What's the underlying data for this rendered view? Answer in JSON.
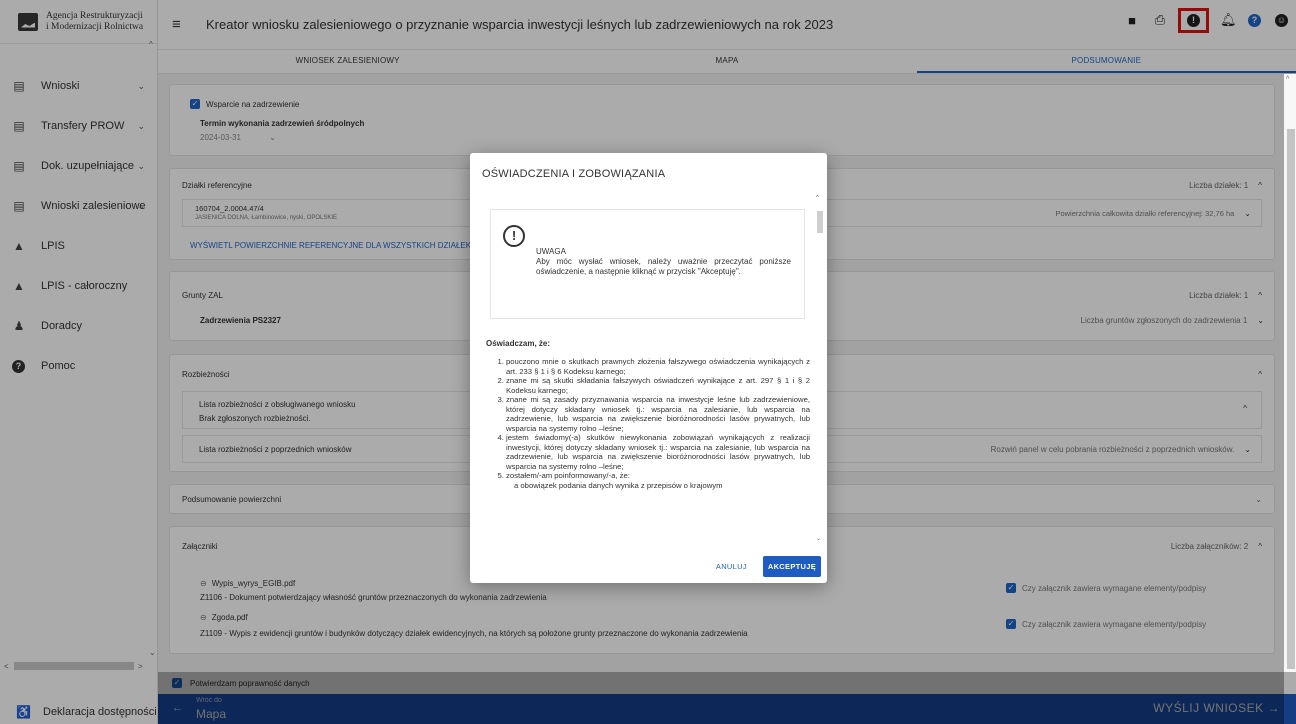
{
  "logo": {
    "line1": "Agencja Restrukturyzacji",
    "line2": "i Modernizacji Rolnictwa"
  },
  "app_title": "Kreator wniosku zalesieniowego o przyznanie wsparcia inwestycji leśnych lub zadrzewieniowych na rok 2023",
  "top_icons": [
    "save-icon",
    "print-icon",
    "info-icon",
    "bell-icon",
    "help-icon",
    "account-icon"
  ],
  "tabs": [
    {
      "label": "WNIOSEK ZALESIENIOWY"
    },
    {
      "label": "MAPA"
    },
    {
      "label": "PODSUMOWANIE",
      "active": true
    }
  ],
  "sidebar": {
    "items": [
      {
        "label": "Wnioski",
        "icon": "document-icon",
        "expandable": true
      },
      {
        "label": "Transfery PROW",
        "icon": "document-icon",
        "expandable": true
      },
      {
        "label": "Dok. uzupełniające",
        "icon": "document-icon",
        "expandable": true
      },
      {
        "label": "Wnioski zalesieniowe",
        "icon": "document-icon",
        "expandable": true
      },
      {
        "label": "LPIS",
        "icon": "mountain-icon"
      },
      {
        "label": "LPIS - całoroczny",
        "icon": "mountain-icon"
      },
      {
        "label": "Doradcy",
        "icon": "person-icon"
      },
      {
        "label": "Pomoc",
        "icon": "help-icon"
      }
    ],
    "footer": "Deklaracja dostępności"
  },
  "sections": {
    "support": {
      "checkbox_label": "Wsparcie na zadrzewienie",
      "term_label": "Termin wykonania zadrzewień śródpolnych",
      "term_value": "2024-03-31"
    },
    "plots": {
      "title": "Działki referencyjne",
      "count": "Liczba działek: 1",
      "plot_id": "160704_2.0004.47/4",
      "plot_loc": "JASIENICA DOLNA, Łambinowice, nyski, OPOLSKIE",
      "area": "Powierzchnia całkowita działki referencyjnej: 32,76 ha",
      "link": "WYŚWIETL POWIERZCHNIE REFERENCYJNE DLA WSZYSTKICH DZIAŁEK"
    },
    "zal": {
      "title": "Grunty ZAL",
      "count": "Liczba działek: 1",
      "item": "Zadrzewienia PS2327",
      "item_count": "Liczba gruntów zgłoszonych do zadrzewienia 1"
    },
    "discrepancies": {
      "title": "Rozbieżności",
      "current_title": "Lista rozbieżności z obsługiwanego wniosku",
      "current_value": "Brak zgłoszonych rozbieżności.",
      "previous_title": "Lista rozbieżności z poprzednich wniosków",
      "previous_hint": "Rozwiń panel w celu pobrania rozbieżności z poprzednich wniosków."
    },
    "area_summary": {
      "title": "Podsumowanie powierzchni"
    },
    "attachments": {
      "title": "Załączniki",
      "count": "Liczba załączników: 2",
      "items": [
        {
          "file": "Wypis_wyrys_EGIB.pdf",
          "desc": "Z1106 - Dokument potwierdzający własność gruntów przeznaczonych do wykonania zadrzewienia",
          "check": "Czy załącznik zawiera wymagane elementy/podpisy"
        },
        {
          "file": "Zgoda.pdf",
          "desc": "Z1109 - Wypis z ewidencji gruntów i budynków dotyczący działek ewidencyjnych, na których są położone grunty przeznaczone do wykonania zadrzewienia",
          "check": "Czy załącznik zawiera wymagane elementy/podpisy"
        }
      ]
    }
  },
  "confirm_label": "Potwierdzam poprawność danych",
  "bottom": {
    "back_small": "Wróć do",
    "back_big": "Mapa",
    "send": "WYŚLIJ WNIOSEK"
  },
  "modal": {
    "title": "OŚWIADCZENIA I ZOBOWIĄZANIA",
    "warn_title": "UWAGA",
    "warn_text": "Aby móc wysłać wniosek, należy uważnie przeczytać poniższe oświadczenie, a następnie kliknąć w przycisk \"Akceptuję\".",
    "decl_head": "Oświadczam, że:",
    "decl_items": [
      "pouczono mnie o skutkach prawnych złożenia fałszywego oświadczenia wynikających z art. 233 § 1 i § 6 Kodeksu karnego;",
      "znane mi są skutki składania fałszywych oświadczeń wynikające z art. 297 § 1 i § 2 Kodeksu karnego;",
      "znane mi są zasady przyznawania wsparcia na inwestycje leśne lub zadrzewieniowe, której dotyczy składany wniosek tj.: wsparcia na zalesianie, lub wsparcia na zadrzewienie, lub wsparcia na zwiększenie bioróżnorodności lasów prywatnych, lub wsparcia na systemy rolno –leśne;",
      "jestem świadomy(-a) skutków niewykonania zobowiązań wynikających z realizacji inwestycji, której dotyczy składany wniosek tj.: wsparcia na zalesianie, lub wsparcia na zadrzewienie, lub wsparcia na zwiększenie bioróżnorodności lasów prywatnych, lub wsparcia na systemy rolno –leśne;",
      "zostałem/-am poinformowany/-a, że:",
      "a obowiązek podania danych wynika z przepisów o krajowym"
    ],
    "cancel": "ANULUJ",
    "accept": "AKCEPTUJĘ"
  }
}
